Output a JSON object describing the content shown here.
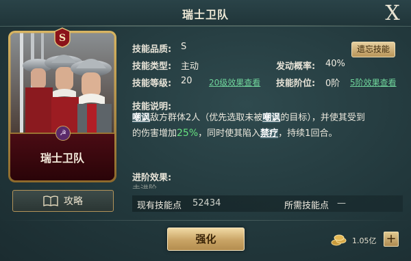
{
  "window": {
    "title": "瑞士卫队"
  },
  "card": {
    "name": "瑞士卫队",
    "grade_letter": "S"
  },
  "guide_button": {
    "label": "攻略"
  },
  "forget_button": {
    "label": "遗忘技能"
  },
  "skill": {
    "quality_label": "技能品质:",
    "quality_value": "S",
    "type_label": "技能类型:",
    "type_value": "主动",
    "level_label": "技能等级:",
    "level_value": "20",
    "level_link": "20级效果查看",
    "chance_label": "发动概率:",
    "chance_value": "40%",
    "stage_label": "技能阶位:",
    "stage_value": "0阶",
    "stage_link": "5阶效果查看"
  },
  "description": {
    "label": "技能说明:",
    "kw_taunt": "嘲讽",
    "part1": "敌方群体2人（优先选取未被",
    "kw_taunt2": "嘲讽",
    "part2": "的目标），并使其受到",
    "part3": "的伤害增加",
    "percent": "25%",
    "part4": "，同时使其陷入",
    "kw_ban": "禁疗",
    "part5": "，持续1回合。"
  },
  "advance": {
    "label": "进阶效果:",
    "first_line": "未进阶"
  },
  "points": {
    "owned_label": "现有技能点",
    "owned_value": "52434",
    "required_label": "所需技能点",
    "required_value": "—"
  },
  "strengthen_button": {
    "label": "强化"
  },
  "currency": {
    "amount": "1.05亿"
  },
  "colors": {
    "accent_green": "#67e27f",
    "gold": "#c9a465",
    "link_green": "#6fd49b"
  }
}
